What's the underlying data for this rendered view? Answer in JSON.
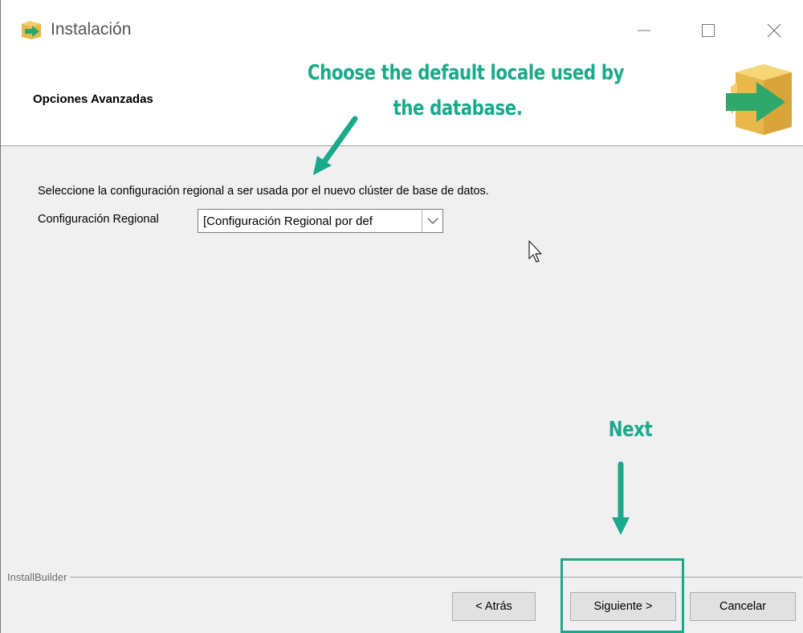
{
  "window": {
    "title": "Instalación",
    "controls": [
      "minimize",
      "maximize",
      "close"
    ]
  },
  "header": {
    "title": "Opciones Avanzadas",
    "icon": "installer-box-arrow-icon"
  },
  "content": {
    "description": "Seleccione la configuración regional a ser usada por el nuevo clúster de base de datos.",
    "locale_label": "Configuración Regional",
    "locale_value": "[Configuración Regional por def"
  },
  "footer": {
    "brand": "InstallBuilder",
    "back_label": "< Atrás",
    "next_label": "Siguiente >",
    "cancel_label": "Cancelar"
  },
  "annotations": {
    "locale_line1": "Choose the default locale used by",
    "locale_line2": "the database.",
    "next": "Next",
    "color": "#1aa98a"
  }
}
